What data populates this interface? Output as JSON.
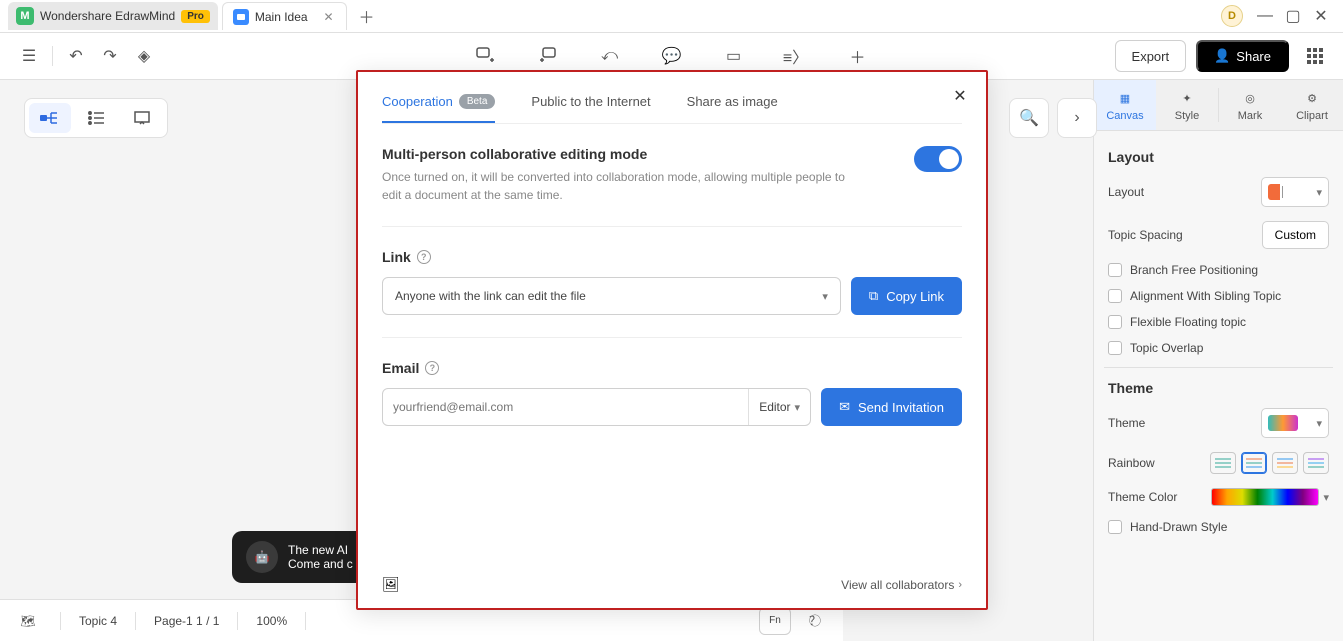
{
  "titlebar": {
    "app_name": "Wondershare EdrawMind",
    "pro_badge": "Pro",
    "active_tab": "Main Idea",
    "avatar_letter": "D"
  },
  "toolbar": {
    "export_label": "Export",
    "share_label": "Share"
  },
  "right_panel": {
    "tabs": {
      "canvas": "Canvas",
      "style": "Style",
      "mark": "Mark",
      "clipart": "Clipart"
    },
    "layout_section": "Layout",
    "layout_label": "Layout",
    "topic_spacing_label": "Topic Spacing",
    "custom_btn": "Custom",
    "checks": {
      "branch_free": "Branch Free Positioning",
      "align_sibling": "Alignment With Sibling Topic",
      "flex_float": "Flexible Floating topic",
      "topic_overlap": "Topic Overlap"
    },
    "theme_section": "Theme",
    "theme_label": "Theme",
    "rainbow_label": "Rainbow",
    "theme_color_label": "Theme Color",
    "hand_drawn_label": "Hand-Drawn Style"
  },
  "statusbar": {
    "topic": "Topic 4",
    "page": "Page-1  1 / 1",
    "zoom": "100%",
    "fn": "Fn"
  },
  "ai_toast": {
    "line1": "The new AI",
    "line2": "Come and c"
  },
  "modal": {
    "tabs": {
      "cooperation": "Cooperation",
      "cooperation_badge": "Beta",
      "public": "Public to the Internet",
      "share_image": "Share as image"
    },
    "collab": {
      "title": "Multi-person collaborative editing mode",
      "desc": "Once turned on, it will be converted into collaboration mode, allowing multiple people to edit a document at the same time."
    },
    "link": {
      "title": "Link",
      "perm": "Anyone with the link can edit the file",
      "copy_btn": "Copy Link"
    },
    "email": {
      "title": "Email",
      "placeholder": "yourfriend@email.com",
      "role": "Editor",
      "send_btn": "Send Invitation"
    },
    "footer": {
      "view_all": "View all collaborators"
    }
  }
}
